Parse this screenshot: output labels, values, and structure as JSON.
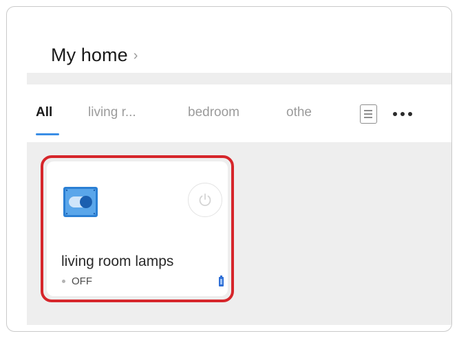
{
  "header": {
    "title": "My home",
    "chevron": "›"
  },
  "tabs": [
    {
      "label": "All",
      "active": true
    },
    {
      "label": "living r...",
      "active": false
    },
    {
      "label": "bedroom",
      "active": false
    },
    {
      "label": "othe",
      "active": false
    }
  ],
  "toolbar": {
    "list_icon": "list-icon",
    "more_icon": "more-icon"
  },
  "device": {
    "name": "living room lamps",
    "status": "OFF",
    "icon": "switch-icon",
    "power_icon": "power-icon",
    "battery_icon": "battery-icon",
    "highlighted": true
  },
  "colors": {
    "accent": "#3a8ee6",
    "highlight": "#d6262b",
    "panel_bg": "#eeeeee",
    "device_icon": "#2a7fd4"
  }
}
